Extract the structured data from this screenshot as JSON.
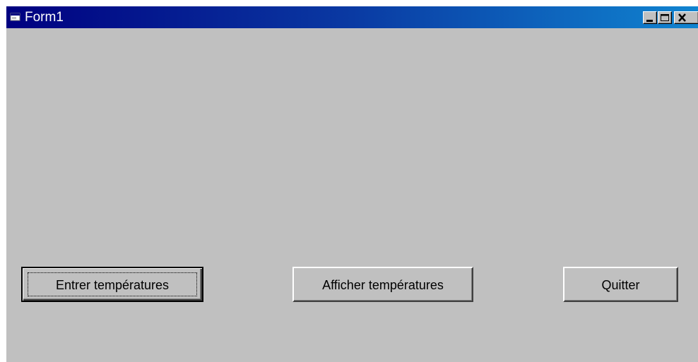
{
  "window": {
    "title": "Form1",
    "icon": "form-icon"
  },
  "title_controls": {
    "minimize": "minimize-icon",
    "maximize": "maximize-icon",
    "close": "close-icon"
  },
  "buttons": {
    "entrer_label": "Entrer températures",
    "afficher_label": "Afficher températures",
    "quitter_label": "Quitter"
  },
  "colors": {
    "form_background": "#c0c0c0",
    "titlebar_start": "#000080",
    "titlebar_end": "#1084d0"
  }
}
